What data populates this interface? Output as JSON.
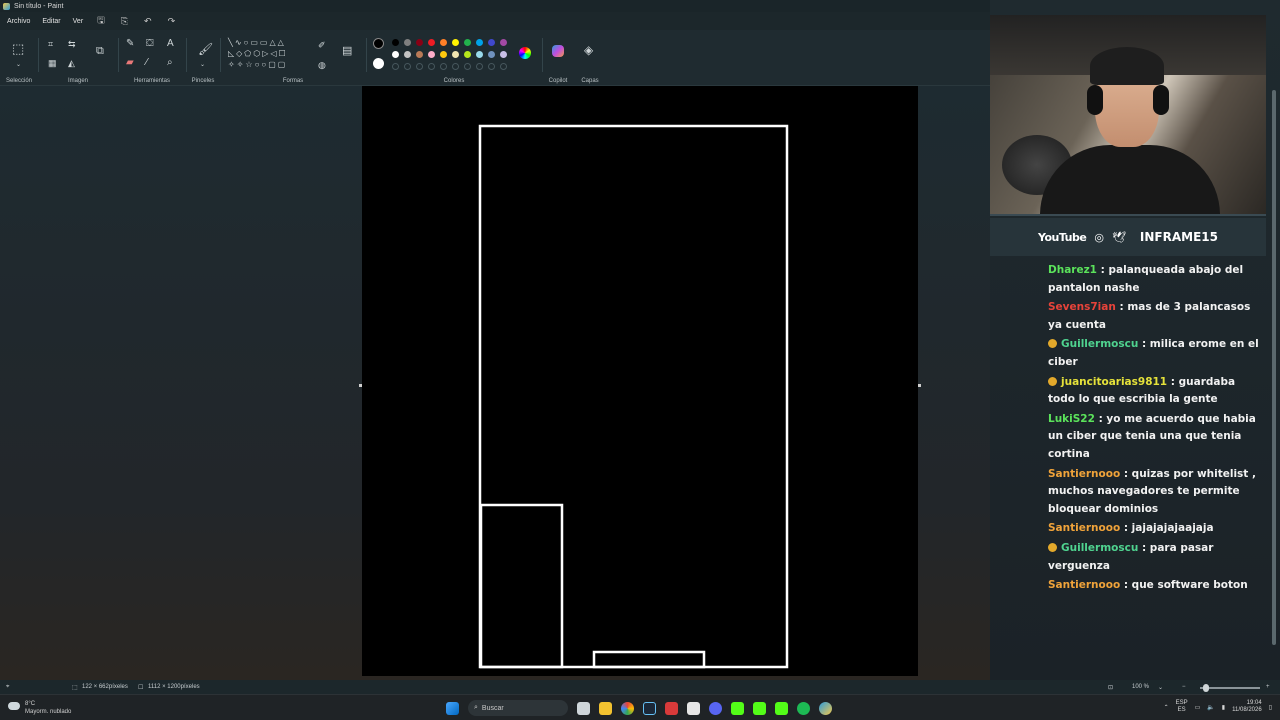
{
  "window": {
    "title": "Sin título - Paint",
    "controls": [
      "–",
      "□",
      "✕"
    ]
  },
  "menu": {
    "items": [
      "Archivo",
      "Editar",
      "Ver"
    ]
  },
  "ribbon": {
    "groups": {
      "seleccion": "Selección",
      "imagen": "Imagen",
      "herramientas": "Herramientas",
      "pinceles": "Pinceles",
      "formas": "Formas",
      "colores": "Colores",
      "copilot": "Copilot",
      "capas": "Capas"
    },
    "colors": {
      "primary": "#000000",
      "secondary": "#ffffff",
      "palette_row1": [
        "#000000",
        "#7f7f7f",
        "#880015",
        "#ed1c24",
        "#ff7f27",
        "#fff200",
        "#22b14c",
        "#00a2e8",
        "#3f48cc",
        "#a349a4"
      ],
      "palette_row2": [
        "#ffffff",
        "#c3c3c3",
        "#b97a57",
        "#ffaec9",
        "#ffc90e",
        "#efe4b0",
        "#b5e61d",
        "#99d9ea",
        "#7092be",
        "#c8bfe7"
      ]
    }
  },
  "status": {
    "selection_size": "122 × 662píxeles",
    "canvas_size": "1112 × 1200píxeles",
    "zoom": "100 %"
  },
  "stream": {
    "youtube": "YouTube",
    "handle": "INFRAME15"
  },
  "chat": [
    {
      "user": "Dharez1",
      "color": "#5be35b",
      "badge": false,
      "text": " : palanqueada abajo del pantalon nashe"
    },
    {
      "user": "Sevens7ian",
      "color": "#e8433a",
      "badge": false,
      "text": " : mas de 3 palancasos ya cuenta"
    },
    {
      "user": "Guillermoscu",
      "color": "#4fd38f",
      "badge": true,
      "text": " : milica erome en el ciber"
    },
    {
      "user": "juancitoarias9811",
      "color": "#e5e23a",
      "badge": true,
      "text": " : guardaba todo lo que escribia la gente"
    },
    {
      "user": "LukiS22",
      "color": "#5be35b",
      "badge": false,
      "text": " : yo me acuerdo que habia un ciber que tenia una que tenia cortina"
    },
    {
      "user": "Santiernooo",
      "color": "#f0a33a",
      "badge": false,
      "text": " : quizas por whitelist , muchos navegadores te permite bloquear dominios"
    },
    {
      "user": "Santiernooo",
      "color": "#f0a33a",
      "badge": false,
      "text": " : jajajajajaajaja"
    },
    {
      "user": "Guillermoscu",
      "color": "#4fd38f",
      "badge": true,
      "text": " : para pasar verguenza"
    },
    {
      "user": "Santiernooo",
      "color": "#f0a33a",
      "badge": false,
      "text": " : que software boton"
    }
  ],
  "taskbar": {
    "weather_temp": "8°C",
    "weather_desc": "Mayorm. nublado",
    "search": "Buscar",
    "lang1": "ESP",
    "lang2": "ES",
    "time": "19:04",
    "date": "11/08/2026"
  }
}
